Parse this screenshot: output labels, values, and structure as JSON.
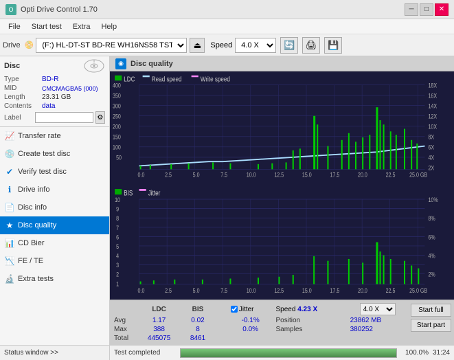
{
  "titleBar": {
    "title": "Opti Drive Control 1.70",
    "icon": "●",
    "minimizeBtn": "─",
    "maximizeBtn": "□",
    "closeBtn": "✕"
  },
  "menuBar": {
    "items": [
      "File",
      "Start test",
      "Extra",
      "Help"
    ]
  },
  "toolbar": {
    "driveLabel": "Drive",
    "driveValue": "(F:)  HL-DT-ST BD-RE  WH16NS58 TST4",
    "ejectIcon": "⏏",
    "speedLabel": "Speed",
    "speedValue": "4.0 X",
    "icons": [
      "◉",
      "🖨",
      "💾"
    ]
  },
  "sidebar": {
    "disc": {
      "title": "Disc",
      "fields": [
        {
          "key": "Type",
          "value": "BD-R",
          "colored": true
        },
        {
          "key": "MID",
          "value": "CMCMAGBA5 (000)",
          "colored": true
        },
        {
          "key": "Length",
          "value": "23.31 GB",
          "colored": false
        },
        {
          "key": "Contents",
          "value": "data",
          "colored": true
        }
      ],
      "labelKey": "Label",
      "labelValue": "",
      "labelPlaceholder": ""
    },
    "navItems": [
      {
        "id": "transfer-rate",
        "label": "Transfer rate",
        "icon": "📈"
      },
      {
        "id": "create-test-disc",
        "label": "Create test disc",
        "icon": "💿"
      },
      {
        "id": "verify-test-disc",
        "label": "Verify test disc",
        "icon": "✔"
      },
      {
        "id": "drive-info",
        "label": "Drive info",
        "icon": "ℹ"
      },
      {
        "id": "disc-info",
        "label": "Disc info",
        "icon": "📄"
      },
      {
        "id": "disc-quality",
        "label": "Disc quality",
        "icon": "★",
        "active": true
      },
      {
        "id": "cd-bier",
        "label": "CD Bier",
        "icon": "📊"
      },
      {
        "id": "fe-te",
        "label": "FE / TE",
        "icon": "📉"
      },
      {
        "id": "extra-tests",
        "label": "Extra tests",
        "icon": "🔬"
      }
    ],
    "statusWindow": "Status window >>"
  },
  "qualityPanel": {
    "title": "Disc quality",
    "legend": {
      "ldc": "LDC",
      "readSpeed": "Read speed",
      "writeSpeed": "Write speed"
    },
    "legend2": {
      "bis": "BIS",
      "jitter": "Jitter"
    },
    "chart1": {
      "yMax": 400,
      "yMin": 0,
      "yLabels": [
        "400",
        "350",
        "300",
        "250",
        "200",
        "150",
        "100",
        "50"
      ],
      "yLabelsRight": [
        "18X",
        "16X",
        "14X",
        "12X",
        "10X",
        "8X",
        "6X",
        "4X",
        "2X"
      ],
      "xLabels": [
        "0.0",
        "2.5",
        "5.0",
        "7.5",
        "10.0",
        "12.5",
        "15.0",
        "17.5",
        "20.0",
        "22.5",
        "25.0 GB"
      ]
    },
    "chart2": {
      "yMax": 10,
      "yMin": 1,
      "yLabels": [
        "10",
        "9",
        "8",
        "7",
        "6",
        "5",
        "4",
        "3",
        "2",
        "1"
      ],
      "yLabelsRight": [
        "10%",
        "8%",
        "6%",
        "4%",
        "2%"
      ],
      "xLabels": [
        "0.0",
        "2.5",
        "5.0",
        "7.5",
        "10.0",
        "12.5",
        "15.0",
        "17.5",
        "20.0",
        "22.5",
        "25.0 GB"
      ]
    }
  },
  "statsBar": {
    "headers": [
      "LDC",
      "BIS",
      "",
      "Jitter",
      "Speed",
      "4.23 X",
      "4.0 X"
    ],
    "jitterChecked": true,
    "rows": [
      {
        "label": "Avg",
        "ldc": "1.17",
        "bis": "0.02",
        "jitter": "-0.1%"
      },
      {
        "label": "Max",
        "ldc": "388",
        "bis": "8",
        "jitter": "0.0%"
      },
      {
        "label": "Total",
        "ldc": "445075",
        "bis": "8461",
        "jitter": ""
      }
    ],
    "position": {
      "label": "Position",
      "value": "23862 MB"
    },
    "samples": {
      "label": "Samples",
      "value": "380252"
    },
    "startFullBtn": "Start full",
    "startPartBtn": "Start part"
  },
  "progressBar": {
    "percentage": "100.0%",
    "fill": 100,
    "time": "31:24",
    "statusText": "Test completed"
  },
  "colors": {
    "accent": "#0078d4",
    "chartBg": "#1a1a3a",
    "gridLine": "#2a2a5a",
    "ldcColor": "#00cc00",
    "readSpeedColor": "#aaddff",
    "bisColor": "#00cc00",
    "jitterColor": "#ff88ff"
  }
}
